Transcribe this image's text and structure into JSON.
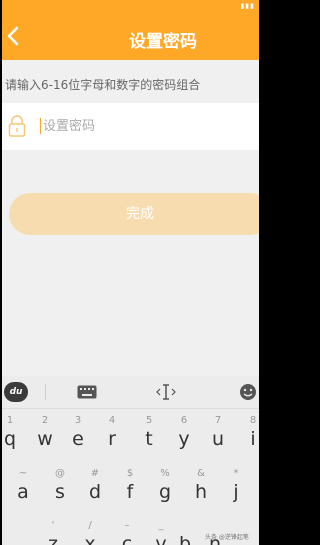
{
  "colors": {
    "accent": "#ffa726",
    "button_disabled": "#f7dcaf",
    "background": "#f0f0f0"
  },
  "header": {
    "title": "设置密码",
    "back_icon": "chevron-left-icon"
  },
  "form": {
    "hint": "请输入6-16位字母和数字的密码组合",
    "password": {
      "value": "",
      "placeholder": "设置密码",
      "icon": "lock-icon"
    },
    "submit_label": "完成"
  },
  "keyboard": {
    "toolbar": {
      "logo": "du",
      "icons": [
        "keyboard-icon",
        "text-cursor-icon",
        "emoji-icon"
      ]
    },
    "row1": [
      {
        "alt": "1",
        "main": "q"
      },
      {
        "alt": "2",
        "main": "w"
      },
      {
        "alt": "3",
        "main": "e"
      },
      {
        "alt": "4",
        "main": "r"
      },
      {
        "alt": "5",
        "main": "t"
      },
      {
        "alt": "6",
        "main": "y"
      },
      {
        "alt": "7",
        "main": "u"
      },
      {
        "alt": "8",
        "main": "i"
      }
    ],
    "row2": [
      {
        "alt": "~",
        "main": "a"
      },
      {
        "alt": "@",
        "main": "s"
      },
      {
        "alt": "#",
        "main": "d"
      },
      {
        "alt": "$",
        "main": "f"
      },
      {
        "alt": "%",
        "main": "g"
      },
      {
        "alt": "&",
        "main": "h"
      },
      {
        "alt": "*",
        "main": "j"
      }
    ],
    "row3": [
      {
        "alt": "'",
        "main": "z"
      },
      {
        "alt": "/",
        "main": "x"
      },
      {
        "alt": "–",
        "main": "c"
      },
      {
        "alt": "_",
        "main": "v"
      },
      {
        "alt": "",
        "main": "b"
      },
      {
        "alt": "",
        "main": "n"
      }
    ]
  },
  "watermark": "头条 @逆锋起笔"
}
